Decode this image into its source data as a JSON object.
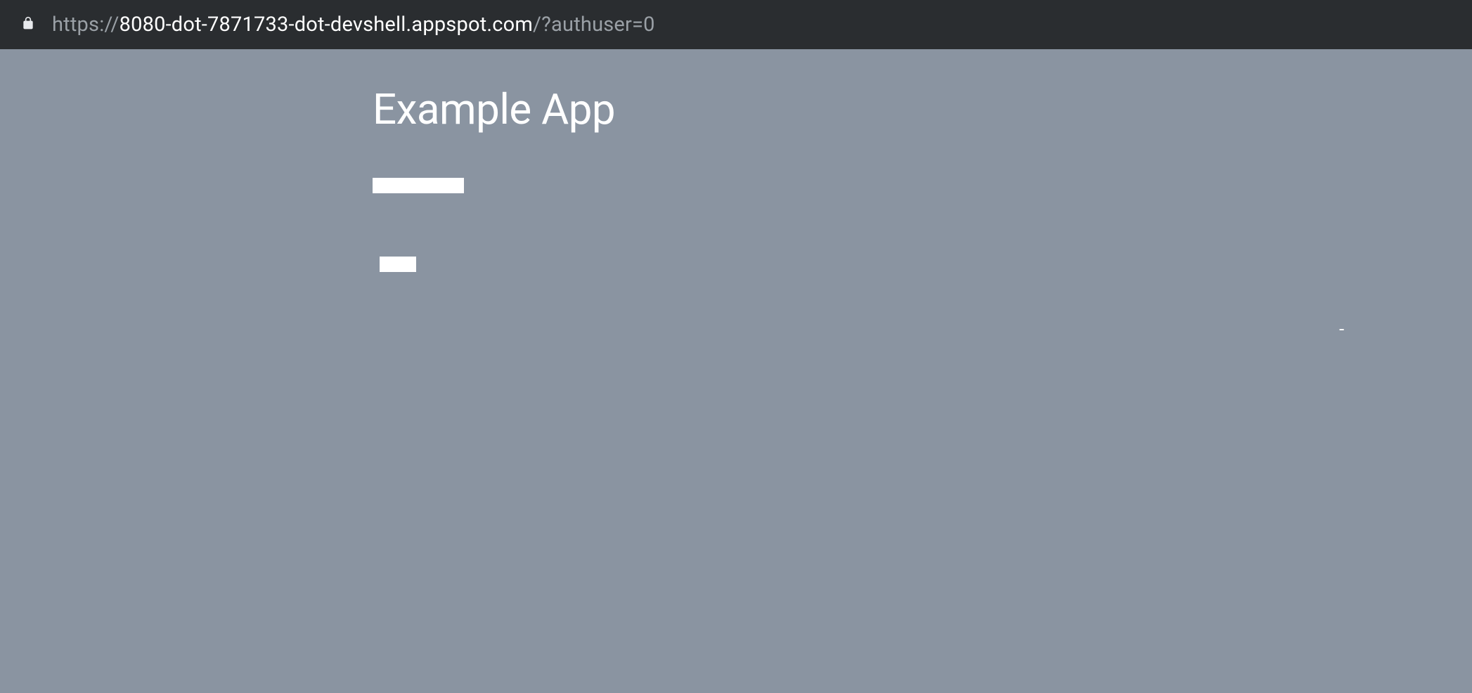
{
  "browser": {
    "url_protocol": "https://",
    "url_host": "8080-dot-7871733-dot-devshell.appspot.com",
    "url_path": "/?authuser=0"
  },
  "page": {
    "title": "Example App",
    "dash": "-"
  }
}
